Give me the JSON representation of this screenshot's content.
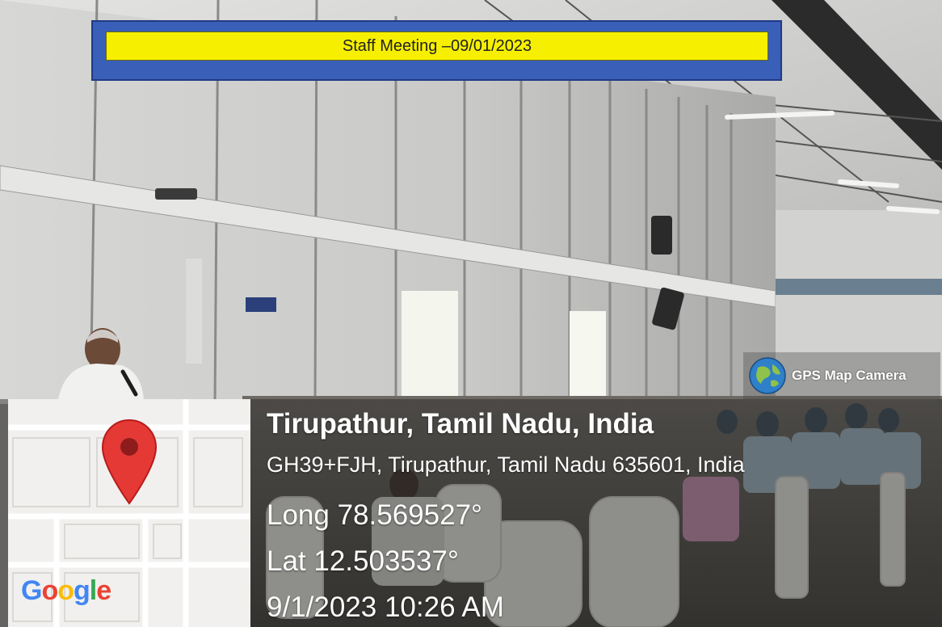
{
  "banner": {
    "title": "Staff Meeting –0 9/01/2023"
  },
  "gps_badge": {
    "label": "GPS Map Camera",
    "icon": "globe-icon"
  },
  "location": {
    "place": "Tirupathur, Tamil Nadu, India",
    "address": "GH39+FJH, Tirupathur, Tamil Nadu 635601, India",
    "longitude": "Long 78.569527°",
    "latitude": "Lat 12.503537°",
    "datetime": "9/1/2023 10:26 AM"
  },
  "map": {
    "pin_icon": "map-pin-icon",
    "logo": "Google",
    "colors": {
      "pin": "#e53935",
      "map_bg": "#f1f0ee",
      "roads": "#ffffff"
    }
  },
  "colors": {
    "banner_frame": "#3a5fb8",
    "banner_bar": "#f6f000"
  }
}
